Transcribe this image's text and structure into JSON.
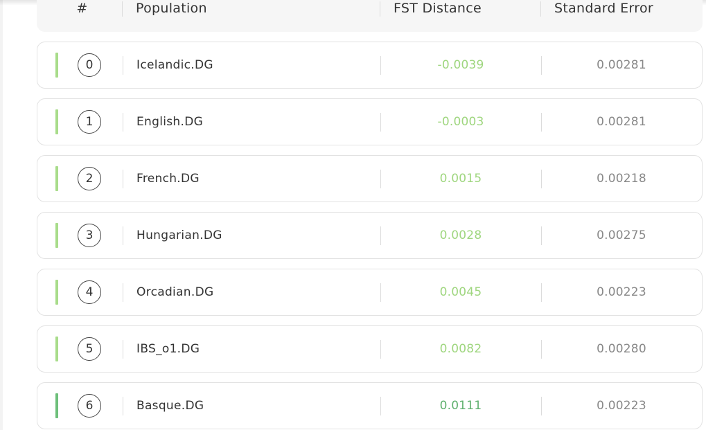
{
  "table": {
    "headers": {
      "index": "#",
      "population": "Population",
      "fst_distance": "FST Distance",
      "standard_error": "Standard Error"
    },
    "rows": [
      {
        "index": "0",
        "population": "Icelandic.DG",
        "fst": "-0.0039",
        "error": "0.00281",
        "bar_color": "#a8dc8a",
        "fst_color": "#9fd67f"
      },
      {
        "index": "1",
        "population": "English.DG",
        "fst": "-0.0003",
        "error": "0.00281",
        "bar_color": "#a8dc8a",
        "fst_color": "#9fd67f"
      },
      {
        "index": "2",
        "population": "French.DG",
        "fst": "0.0015",
        "error": "0.00218",
        "bar_color": "#a8dc8a",
        "fst_color": "#9fd67f"
      },
      {
        "index": "3",
        "population": "Hungarian.DG",
        "fst": "0.0028",
        "error": "0.00275",
        "bar_color": "#a8dc8a",
        "fst_color": "#9fd67f"
      },
      {
        "index": "4",
        "population": "Orcadian.DG",
        "fst": "0.0045",
        "error": "0.00223",
        "bar_color": "#a8dc8a",
        "fst_color": "#9fd67f"
      },
      {
        "index": "5",
        "population": "IBS_o1.DG",
        "fst": "0.0082",
        "error": "0.00280",
        "bar_color": "#a8dc8a",
        "fst_color": "#9fd67f"
      },
      {
        "index": "6",
        "population": "Basque.DG",
        "fst": "0.0111",
        "error": "0.00223",
        "bar_color": "#6dbf7a",
        "fst_color": "#5fb06e"
      }
    ]
  }
}
